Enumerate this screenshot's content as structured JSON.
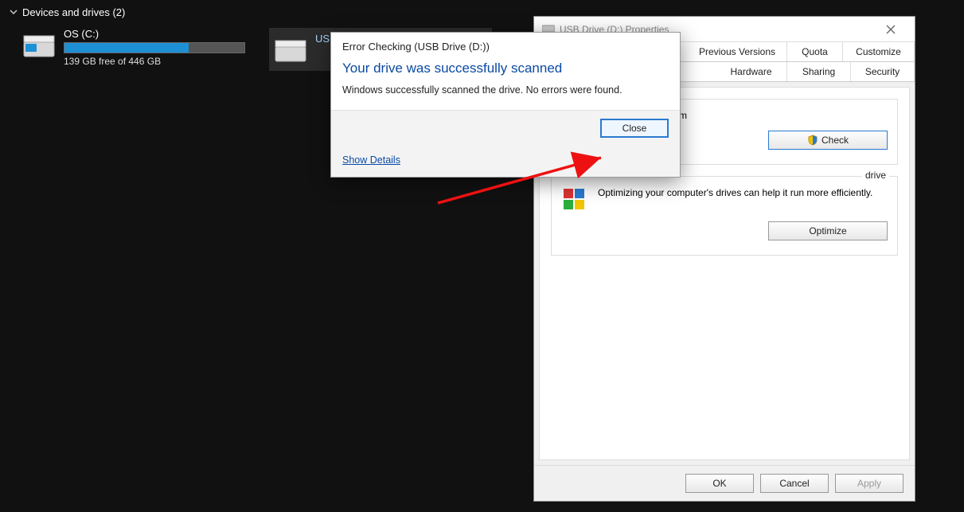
{
  "explorer": {
    "section_label": "Devices and drives (2)",
    "drives": [
      {
        "name": "OS (C:)",
        "free_text": "139 GB free of 446 GB",
        "fill_pct": 69
      },
      {
        "name": "USB Drive (D:)",
        "free_text": ""
      }
    ]
  },
  "dialog": {
    "title": "Error Checking (USB Drive (D:))",
    "heading": "Your drive was successfully scanned",
    "message": "Windows successfully scanned the drive. No errors were found.",
    "close_label": "Close",
    "show_details_label": "Show Details"
  },
  "properties": {
    "title": "USB Drive (D:) Properties",
    "tabs_row1": [
      "Previous Versions",
      "Quota",
      "Customize"
    ],
    "tabs_row2": [
      "Hardware",
      "Sharing",
      "Security"
    ],
    "error_group": {
      "text": "check the drive for file system",
      "button": "Check"
    },
    "optimize_group": {
      "title": "drive",
      "text": "Optimizing your computer's drives can help it run more efficiently.",
      "button": "Optimize"
    },
    "footer": {
      "ok": "OK",
      "cancel": "Cancel",
      "apply": "Apply"
    }
  }
}
